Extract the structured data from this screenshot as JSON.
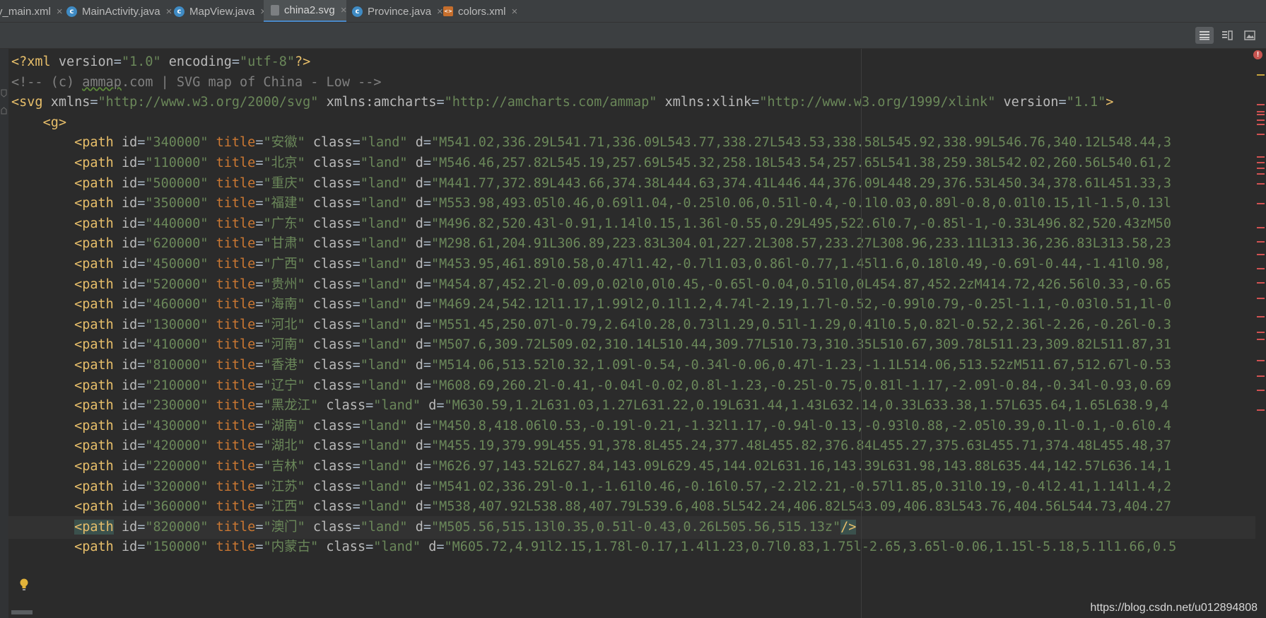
{
  "tabs": [
    {
      "label": "y_main.xml",
      "icon": "xml-layout-file-icon",
      "active": false
    },
    {
      "label": "MainActivity.java",
      "icon": "java-class-icon",
      "active": false
    },
    {
      "label": "MapView.java",
      "icon": "java-class-icon",
      "active": false
    },
    {
      "label": "china2.svg",
      "icon": "svg-file-icon",
      "active": true
    },
    {
      "label": "Province.java",
      "icon": "java-class-icon",
      "active": false
    },
    {
      "label": "colors.xml",
      "icon": "xml-resource-file-icon",
      "active": false
    }
  ],
  "tab_close_glyph": "×",
  "toolbar": {
    "text_mode": "text-view-icon",
    "split_mode": "split-view-icon",
    "preview_mode": "image-preview-icon"
  },
  "code": {
    "xml_decl": {
      "open": "<?xml ",
      "version_attr": "version",
      "version_val": "\"1.0\"",
      "encoding_attr": "encoding",
      "encoding_val": "\"utf-8\"",
      "close": "?>"
    },
    "comment": {
      "pre": "<!-- (c) ",
      "link": "ammap",
      "post": ".com | SVG map of China - Low -->"
    },
    "svg_open": {
      "tag": "<svg",
      "xmlns_attr": "xmlns",
      "xmlns_val": "\"http://www.w3.org/2000/svg\"",
      "amcharts_attr": "xmlns:amcharts",
      "amcharts_val": "\"http://amcharts.com/ammap\"",
      "xlink_attr": "xmlns:xlink",
      "xlink_val": "\"http://www.w3.org/1999/xlink\"",
      "version_attr": "version",
      "version_val": "\"1.1\"",
      "close": ">"
    },
    "g_open": "<g>",
    "path_tag": "<path",
    "id_attr": "id",
    "title_attr": "title",
    "class_attr": "class",
    "d_attr": "d",
    "class_val": "\"land\"",
    "paths": [
      {
        "id": "\"340000\"",
        "title": "\"安徽\"",
        "d": "\"M541.02,336.29L541.71,336.09L543.77,338.27L543.53,338.58L545.92,338.99L546.76,340.12L548.44,3"
      },
      {
        "id": "\"110000\"",
        "title": "\"北京\"",
        "d": "\"M546.46,257.82L545.19,257.69L545.32,258.18L543.54,257.65L541.38,259.38L542.02,260.56L540.61,2"
      },
      {
        "id": "\"500000\"",
        "title": "\"重庆\"",
        "d": "\"M441.77,372.89L443.66,374.38L444.63,374.41L446.44,376.09L448.29,376.53L450.34,378.61L451.33,3"
      },
      {
        "id": "\"350000\"",
        "title": "\"福建\"",
        "d": "\"M553.98,493.05l0.46,0.69l1.04,-0.25l0.06,0.51l-0.4,-0.1l0.03,0.89l-0.8,0.01l0.15,1l-1.5,0.13l"
      },
      {
        "id": "\"440000\"",
        "title": "\"广东\"",
        "d": "\"M496.82,520.43l-0.91,1.14l0.15,1.36l-0.55,0.29L495,522.6l0.7,-0.85l-1,-0.33L496.82,520.43zM50"
      },
      {
        "id": "\"620000\"",
        "title": "\"甘肃\"",
        "d": "\"M298.61,204.91L306.89,223.83L304.01,227.2L308.57,233.27L308.96,233.11L313.36,236.83L313.58,23"
      },
      {
        "id": "\"450000\"",
        "title": "\"广西\"",
        "d": "\"M453.95,461.89l0.58,0.47l1.42,-0.7l1.03,0.86l-0.77,1.45l1.6,0.18l0.49,-0.69l-0.44,-1.41l0.98,"
      },
      {
        "id": "\"520000\"",
        "title": "\"贵州\"",
        "d": "\"M454.87,452.2l-0.09,0.02l0,0l0.45,-0.65l-0.04,0.51l0,0L454.87,452.2zM414.72,426.56l0.33,-0.65"
      },
      {
        "id": "\"460000\"",
        "title": "\"海南\"",
        "d": "\"M469.24,542.12l1.17,1.99l2,0.1l1.2,4.74l-2.19,1.7l-0.52,-0.99l0.79,-0.25l-1.1,-0.03l0.51,1l-0"
      },
      {
        "id": "\"130000\"",
        "title": "\"河北\"",
        "d": "\"M551.45,250.07l-0.79,2.64l0.28,0.73l1.29,0.51l-1.29,0.41l0.5,0.82l-0.52,2.36l-2.26,-0.26l-0.3"
      },
      {
        "id": "\"410000\"",
        "title": "\"河南\"",
        "d": "\"M507.6,309.72L509.02,310.14L510.44,309.77L510.73,310.35L510.67,309.78L511.23,309.82L511.87,31"
      },
      {
        "id": "\"810000\"",
        "title": "\"香港\"",
        "d": "\"M514.06,513.52l0.32,1.09l-0.54,-0.34l-0.06,0.47l-1.23,-1.1L514.06,513.52zM511.67,512.67l-0.53"
      },
      {
        "id": "\"210000\"",
        "title": "\"辽宁\"",
        "d": "\"M608.69,260.2l-0.41,-0.04l-0.02,0.8l-1.23,-0.25l-0.75,0.81l-1.17,-2.09l-0.84,-0.34l-0.93,0.69"
      },
      {
        "id": "\"230000\"",
        "title": "\"黑龙江\"",
        "d": "\"M630.59,1.2L631.03,1.27L631.22,0.19L631.44,1.43L632.14,0.33L633.38,1.57L635.64,1.65L638.9,4"
      },
      {
        "id": "\"430000\"",
        "title": "\"湖南\"",
        "d": "\"M450.8,418.06l0.53,-0.19l-0.21,-1.32l1.17,-0.94l-0.13,-0.93l0.88,-2.05l0.39,0.1l-0.1,-0.6l0.4"
      },
      {
        "id": "\"420000\"",
        "title": "\"湖北\"",
        "d": "\"M455.19,379.99L455.91,378.8L455.24,377.48L455.82,376.84L455.27,375.63L455.71,374.48L455.48,37"
      },
      {
        "id": "\"220000\"",
        "title": "\"吉林\"",
        "d": "\"M626.97,143.52L627.84,143.09L629.45,144.02L631.16,143.39L631.98,143.88L635.44,142.57L636.14,1"
      },
      {
        "id": "\"320000\"",
        "title": "\"江苏\"",
        "d": "\"M541.02,336.29l-0.1,-1.61l0.46,-0.16l0.57,-2.2l2.21,-0.57l1.85,0.31l0.19,-0.4l2.41,1.14l1.4,2"
      },
      {
        "id": "\"360000\"",
        "title": "\"江西\"",
        "d": "\"M538,407.92L538.88,407.79L539.6,408.5L542.24,406.82L543.09,406.83L543.76,404.56L544.73,404.27"
      },
      {
        "id": "\"820000\"",
        "title": "\"澳门\"",
        "d": "\"M505.56,515.13l0.35,0.51l-0.43,0.26L505.56,515.13z\"",
        "close": "/>"
      },
      {
        "id": "\"150000\"",
        "title": "\"内蒙古\"",
        "d": "\"M605.72,4.91l2.15,1.78l-0.17,1.4l1.23,0.7l0.83,1.75l-2.65,3.65l-0.06,1.15l-5.18,5.1l1.66,0.5"
      }
    ]
  },
  "error_marker": "!",
  "watermark": "https://blog.csdn.net/u012894808"
}
